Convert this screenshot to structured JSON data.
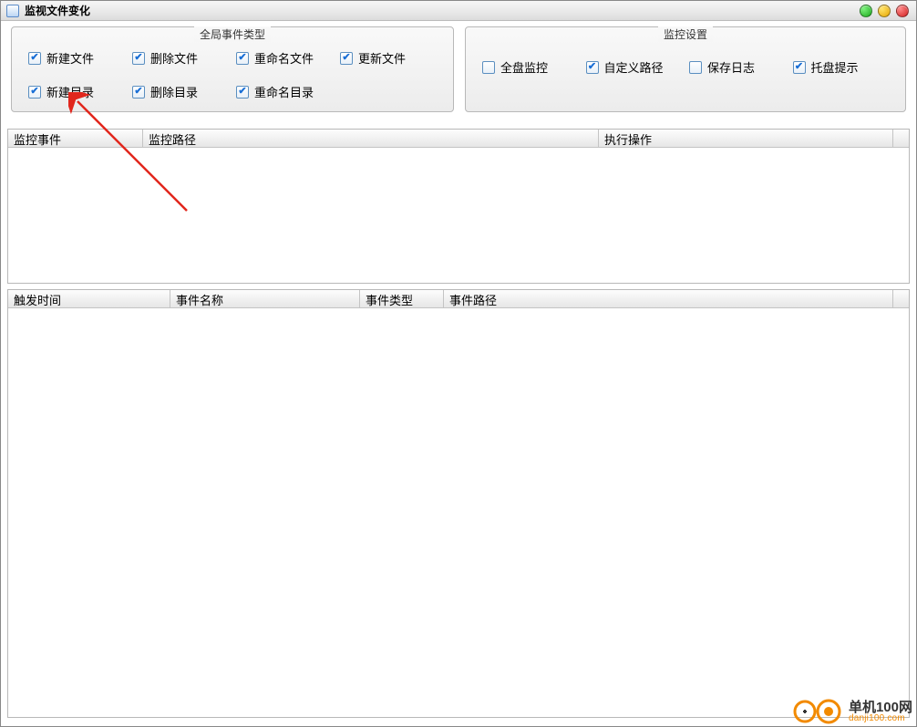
{
  "title": "监视文件变化",
  "event_types_group": {
    "legend": "全局事件类型",
    "items": [
      {
        "label": "新建文件",
        "checked": true
      },
      {
        "label": "删除文件",
        "checked": true
      },
      {
        "label": "重命名文件",
        "checked": true
      },
      {
        "label": "更新文件",
        "checked": true
      },
      {
        "label": "新建目录",
        "checked": true
      },
      {
        "label": "删除目录",
        "checked": true
      },
      {
        "label": "重命名目录",
        "checked": true
      }
    ]
  },
  "monitor_settings_group": {
    "legend": "监控设置",
    "items": [
      {
        "label": "全盘监控",
        "checked": false
      },
      {
        "label": "自定义路径",
        "checked": true
      },
      {
        "label": "保存日志",
        "checked": false
      },
      {
        "label": "托盘提示",
        "checked": true
      }
    ]
  },
  "upper_table": {
    "columns": [
      "监控事件",
      "监控路径",
      "执行操作"
    ]
  },
  "lower_table": {
    "columns": [
      "触发时间",
      "事件名称",
      "事件类型",
      "事件路径"
    ]
  },
  "watermark": {
    "cn": "单机100网",
    "en": "danji100.com"
  }
}
